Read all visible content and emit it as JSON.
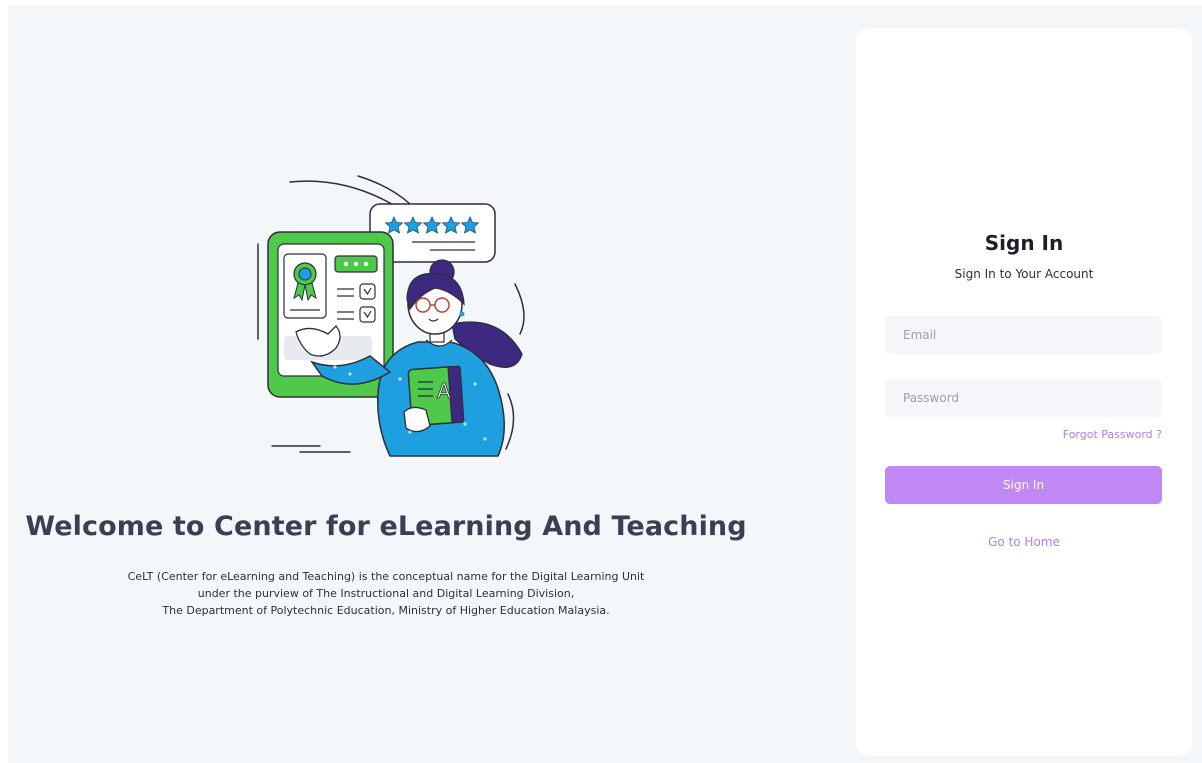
{
  "welcome": {
    "title": "Welcome to Center for eLearning And Teaching",
    "description_lines": [
      "CeLT (Center for eLearning and Teaching) is the conceptual name for the Digital Learning Unit",
      "under the purview of The Instructional and Digital Learning Division,",
      "The Department of Polytechnic Education, Ministry of Higher Education Malaysia."
    ]
  },
  "illustration": {
    "icon": "elearning-illustration",
    "certificate_letter": "A",
    "rating_stars": 5
  },
  "signin": {
    "title": "Sign In",
    "subtitle": "Sign In to Your Account",
    "email_placeholder": "Email",
    "password_placeholder": "Password",
    "forgot_label": "Forgot Password ?",
    "button_label": "Sign In",
    "home_label": "Go to Home"
  },
  "colors": {
    "accent": "#c187f5",
    "accent_text": "#b07ef0",
    "page_bg": "#f4f7fa",
    "card_bg": "#ffffff",
    "title_text": "#3b3f52"
  }
}
